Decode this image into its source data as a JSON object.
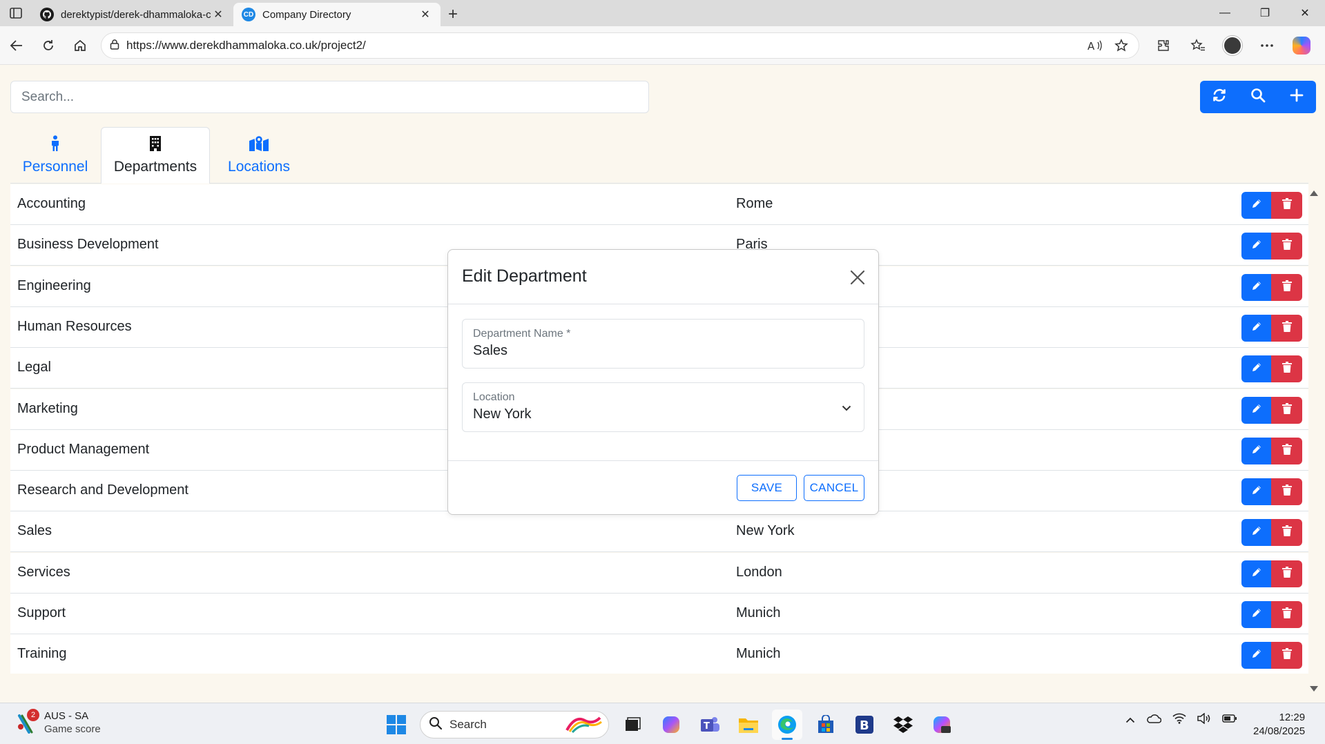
{
  "browser": {
    "tabs": [
      {
        "title": "derektypist/derek-dhammaloka-c",
        "favicon": "github-icon",
        "active": false
      },
      {
        "title": "Company Directory",
        "favicon": "CD",
        "active": true
      }
    ],
    "url": "https://www.derekdhammaloka.co.uk/project2/"
  },
  "page": {
    "search_placeholder": "Search...",
    "action_buttons": [
      "refresh-icon",
      "search-icon",
      "plus-icon"
    ],
    "tabs": [
      {
        "label": "Personnel",
        "icon": "person-icon",
        "active": false
      },
      {
        "label": "Departments",
        "icon": "building-icon",
        "active": true
      },
      {
        "label": "Locations",
        "icon": "map-location-icon",
        "active": false
      }
    ],
    "departments": [
      {
        "name": "Accounting",
        "location": "Rome"
      },
      {
        "name": "Business Development",
        "location": "Paris"
      },
      {
        "name": "Engineering",
        "location": ""
      },
      {
        "name": "Human Resources",
        "location": ""
      },
      {
        "name": "Legal",
        "location": ""
      },
      {
        "name": "Marketing",
        "location": ""
      },
      {
        "name": "Product Management",
        "location": ""
      },
      {
        "name": "Research and Development",
        "location": ""
      },
      {
        "name": "Sales",
        "location": "New York"
      },
      {
        "name": "Services",
        "location": "London"
      },
      {
        "name": "Support",
        "location": "Munich"
      },
      {
        "name": "Training",
        "location": "Munich"
      }
    ]
  },
  "modal": {
    "title": "Edit Department",
    "name_label": "Department Name *",
    "name_value": "Sales",
    "location_label": "Location",
    "location_value": "New York",
    "save_label": "SAVE",
    "cancel_label": "CANCEL"
  },
  "taskbar": {
    "weather_badge": "2",
    "weather_title": "AUS - SA",
    "weather_sub": "Game score",
    "search_label": "Search",
    "time": "12:29",
    "date": "24/08/2025"
  },
  "colors": {
    "primary": "#0d6efd",
    "danger": "#dc3545",
    "page_bg": "#fbf7ee"
  }
}
